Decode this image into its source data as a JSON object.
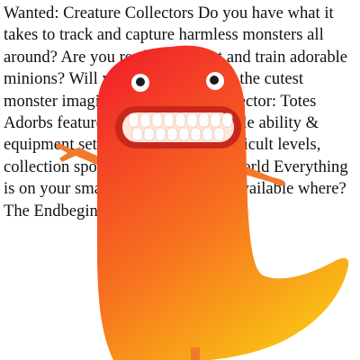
{
  "ad": {
    "body": "Wanted: Creature Collectors Do you have what it takes to track and capture harmless monsters all around? Are you ready to collect and train adorable minions? Will you be victorious in the cutest monster imaginable? Creature Collector: Totes Adorbs features 345 equally adorable ability & equipment settings. Includes 12 difficult levels, collection spots and battles in the world Everything is on your smartphone, wherever. Available where? The Endbeginningning compatible"
  },
  "mascot": {
    "name": "monster-mascot",
    "colors": {
      "body_top": "#f2242a",
      "body_mid": "#f7741f",
      "body_bottom": "#f9c514",
      "mouth": "#c8281c",
      "teeth": "#ffffff",
      "eye": "#ffffff",
      "pupil": "#1a1a1a",
      "arm": "#f07a2c"
    }
  }
}
